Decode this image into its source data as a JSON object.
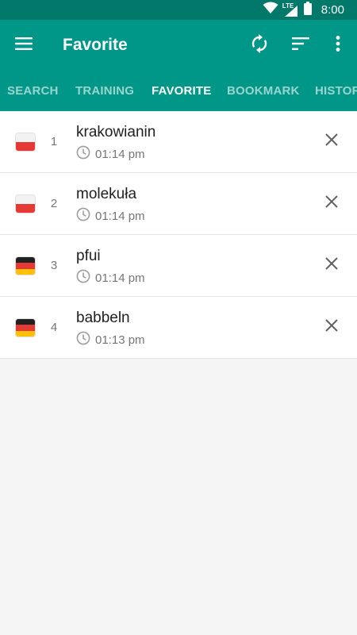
{
  "status_bar": {
    "time": "8:00",
    "network_label": "LTE",
    "icons": [
      "wifi-icon",
      "cell-signal-icon",
      "battery-icon"
    ]
  },
  "app_bar": {
    "title": "Favorite",
    "icons": [
      "menu-icon",
      "sync-icon",
      "sort-icon",
      "more-vert-icon"
    ],
    "colors": {
      "primary": "#009688",
      "primary_dark": "#00796b"
    }
  },
  "tabs": [
    {
      "label": "SEARCH",
      "active": false
    },
    {
      "label": "TRAINING",
      "active": false
    },
    {
      "label": "FAVORITE",
      "active": true
    },
    {
      "label": "BOOKMARK",
      "active": false
    },
    {
      "label": "HISTOR",
      "active": false
    }
  ],
  "items": [
    {
      "index": "1",
      "word": "krakowianin",
      "time": "01:14 pm",
      "flag": "poland"
    },
    {
      "index": "2",
      "word": "molekuła",
      "time": "01:14 pm",
      "flag": "poland"
    },
    {
      "index": "3",
      "word": "pfui",
      "time": "01:14 pm",
      "flag": "germany"
    },
    {
      "index": "4",
      "word": "babbeln",
      "time": "01:13 pm",
      "flag": "germany"
    }
  ],
  "item_icons": {
    "time": "clock-icon",
    "remove": "close-icon"
  }
}
